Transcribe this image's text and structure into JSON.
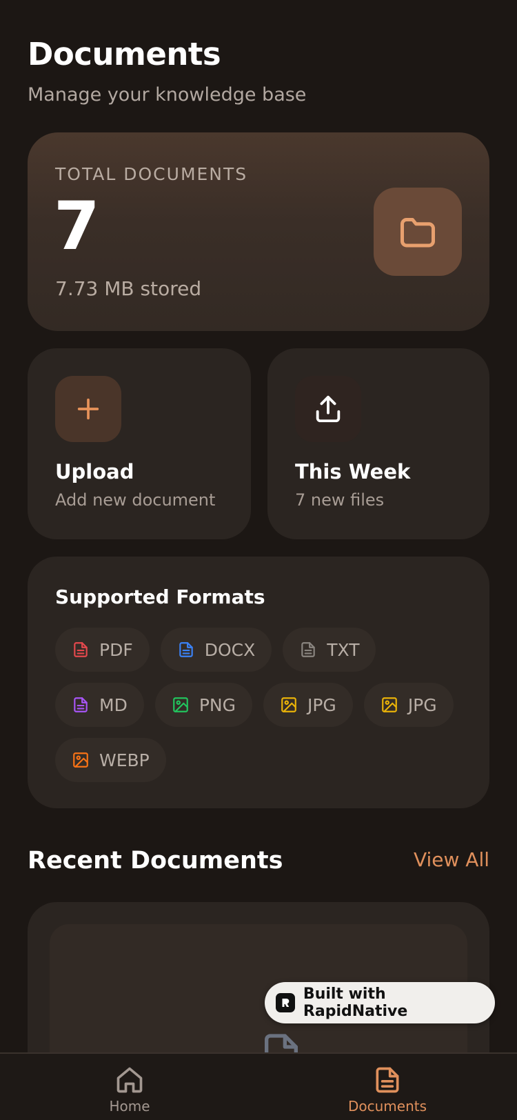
{
  "header": {
    "title": "Documents",
    "subtitle": "Manage your knowledge base"
  },
  "summary": {
    "label": "TOTAL DOCUMENTS",
    "count": "7",
    "size": "7.73 MB stored",
    "icon": "folder-icon"
  },
  "actions": {
    "upload": {
      "title": "Upload",
      "subtitle": "Add new document",
      "icon": "plus-icon"
    },
    "week": {
      "title": "This Week",
      "subtitle": "7 new files",
      "icon": "upload-arrow-icon"
    }
  },
  "formats": {
    "title": "Supported Formats",
    "items": [
      {
        "label": "PDF",
        "color": "#e5484d",
        "icon": "file-text-icon"
      },
      {
        "label": "DOCX",
        "color": "#3b82f6",
        "icon": "file-text-icon"
      },
      {
        "label": "TXT",
        "color": "#8a8580",
        "icon": "file-text-icon"
      },
      {
        "label": "MD",
        "color": "#a855f7",
        "icon": "file-text-icon"
      },
      {
        "label": "PNG",
        "color": "#22c55e",
        "icon": "image-icon"
      },
      {
        "label": "JPG",
        "color": "#eab308",
        "icon": "image-icon"
      },
      {
        "label": "JPG",
        "color": "#eab308",
        "icon": "image-icon"
      },
      {
        "label": "WEBP",
        "color": "#f97316",
        "icon": "image-icon"
      }
    ]
  },
  "recent": {
    "title": "Recent Documents",
    "view_all": "View All"
  },
  "badge": {
    "text": "Built with RapidNative"
  },
  "tabbar": {
    "items": [
      {
        "label": "Home",
        "icon": "home-icon",
        "active": false
      },
      {
        "label": "Documents",
        "icon": "document-icon",
        "active": true
      }
    ]
  },
  "colors": {
    "accent": "#e0905c",
    "background": "#1c1714",
    "card": "#2b2521"
  }
}
